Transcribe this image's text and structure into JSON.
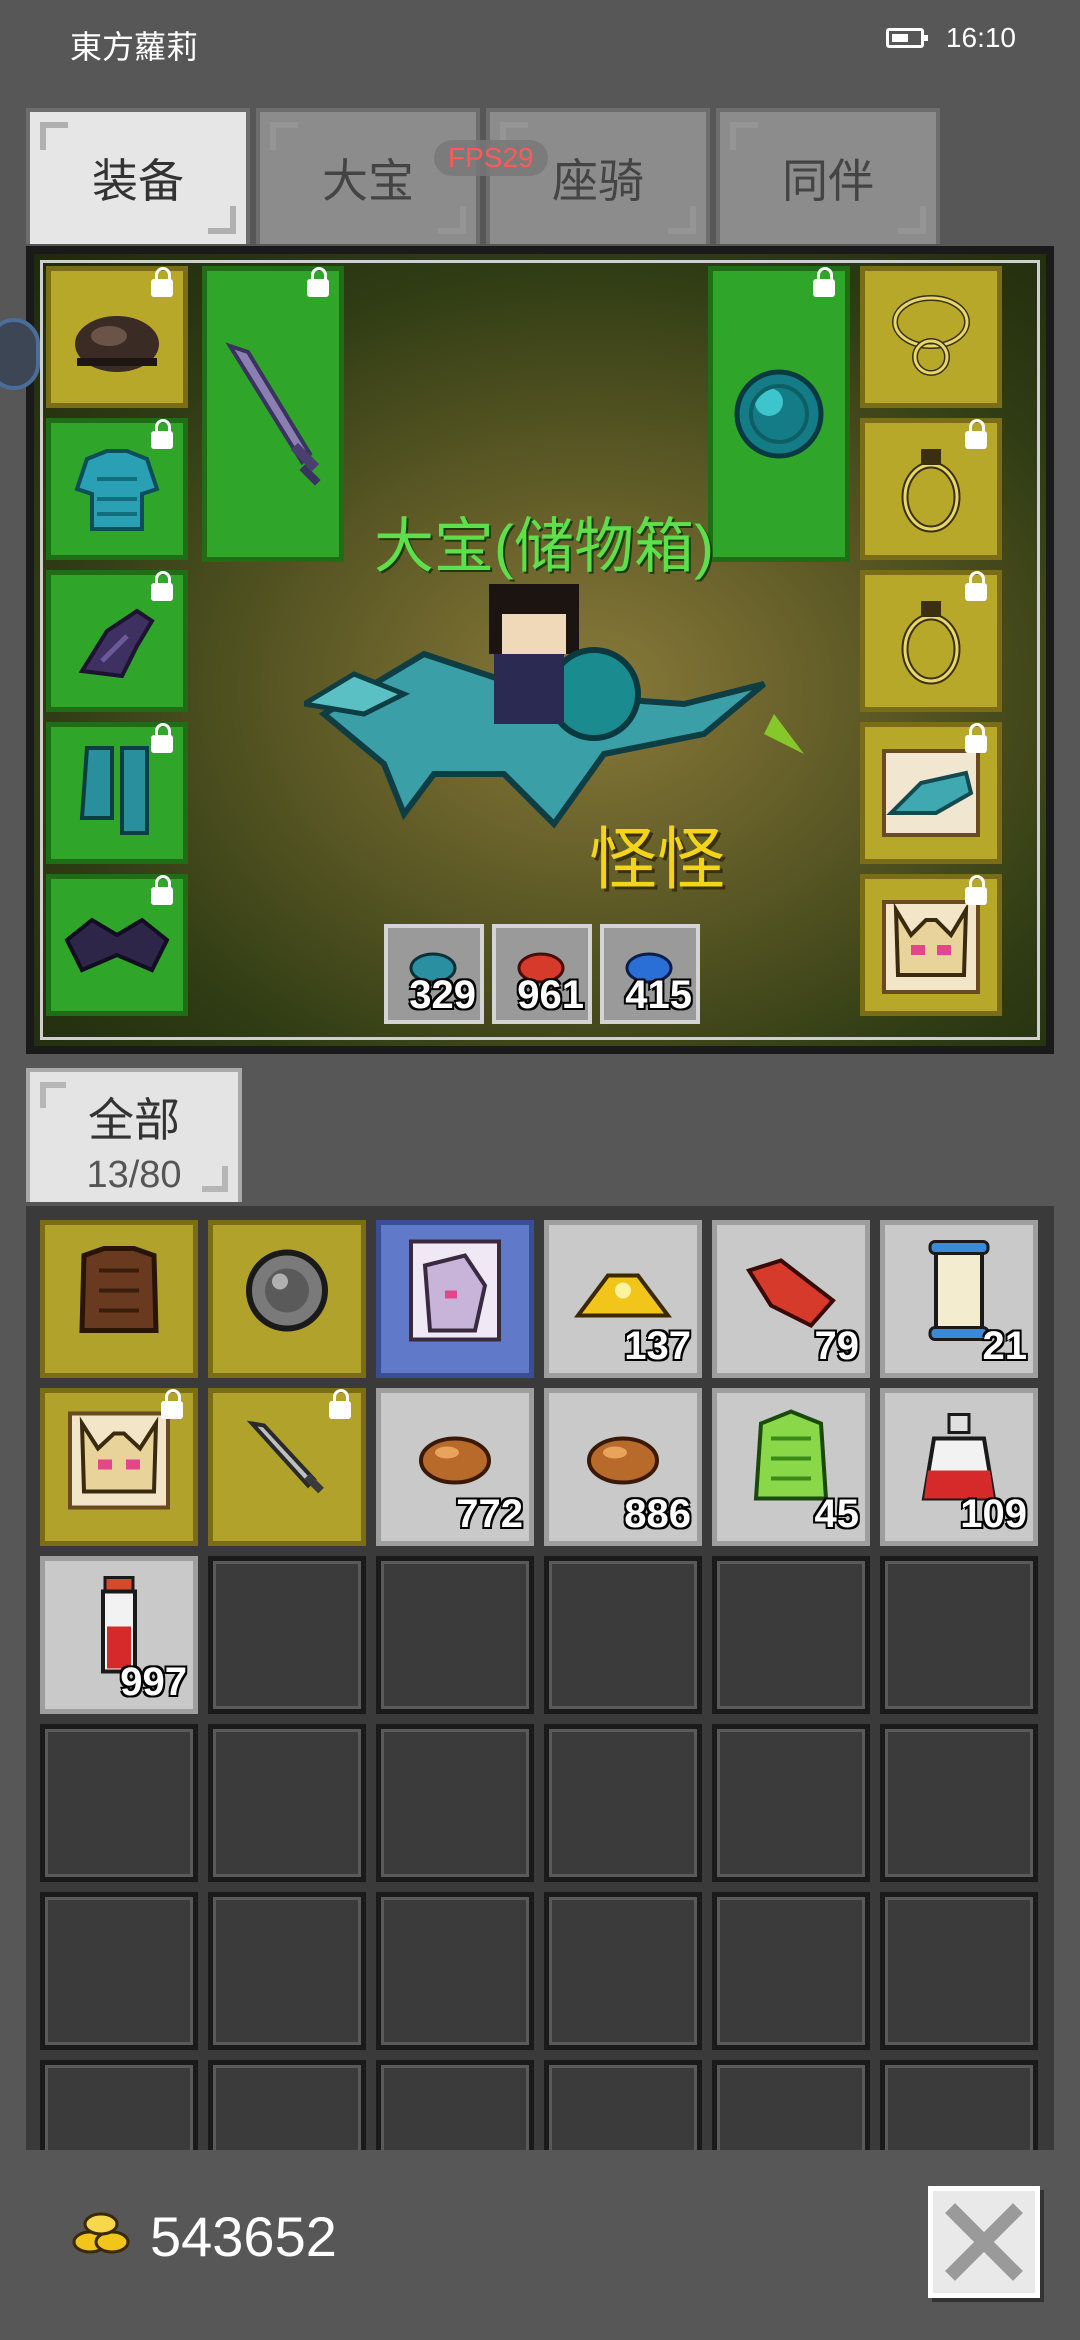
{
  "status": {
    "app": "東方蘿莉",
    "time": "16:10"
  },
  "fps": "FPS29",
  "tabs": [
    {
      "label": "装备",
      "active": true
    },
    {
      "label": "大宝",
      "active": false
    },
    {
      "label": "座骑",
      "active": false
    },
    {
      "label": "同伴",
      "active": false
    }
  ],
  "equip": {
    "character_name": "大宝(储物箱)",
    "pet_name": "怪怪",
    "counters": [
      "329",
      "961",
      "415"
    ]
  },
  "inventory": {
    "tab_label": "全部",
    "capacity": "13/80",
    "items": [
      {
        "name": "leather-armor-icon",
        "qty": "",
        "style": "gold"
      },
      {
        "name": "shield-icon",
        "qty": "",
        "style": "gold"
      },
      {
        "name": "unicorn-card-icon",
        "qty": "",
        "style": "blue"
      },
      {
        "name": "gold-pile-icon",
        "qty": "137",
        "style": "light"
      },
      {
        "name": "red-meat-icon",
        "qty": "79",
        "style": "light"
      },
      {
        "name": "scroll-icon",
        "qty": "21",
        "style": "light"
      },
      {
        "name": "cat-companion-card-icon",
        "qty": "",
        "style": "gold"
      },
      {
        "name": "dagger-icon",
        "qty": "",
        "style": "gold"
      },
      {
        "name": "bread-icon",
        "qty": "772",
        "style": "light"
      },
      {
        "name": "bread-icon",
        "qty": "886",
        "style": "light"
      },
      {
        "name": "herb-bundle-icon",
        "qty": "45",
        "style": "light"
      },
      {
        "name": "health-potion-icon",
        "qty": "109",
        "style": "light"
      },
      {
        "name": "red-potion-vial-icon",
        "qty": "997",
        "style": "light"
      }
    ]
  },
  "gold": "543652",
  "colors": {
    "accent_gold": "#f2d418",
    "name_green": "#5ee04a",
    "slot_green": "#2fa52a",
    "slot_gold": "#b8a82a"
  }
}
